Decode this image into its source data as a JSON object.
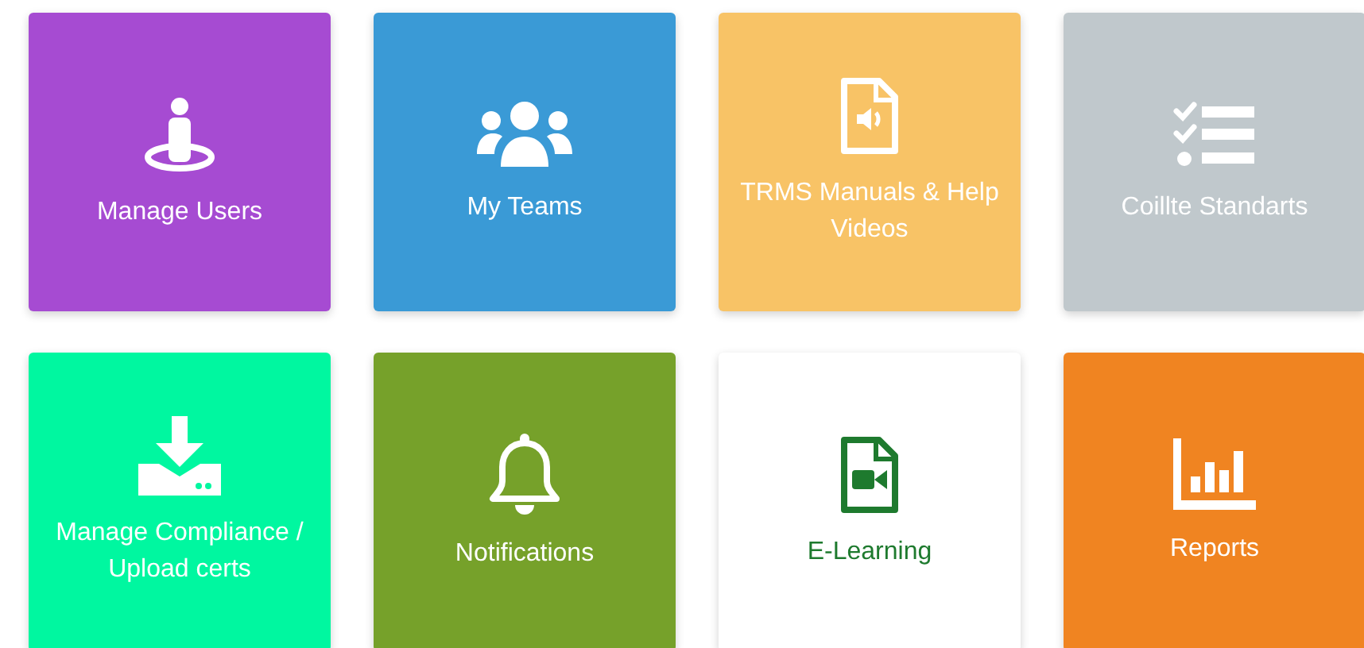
{
  "tiles": [
    {
      "label": "Manage Users",
      "color": "#a64bd2",
      "kind": "solid"
    },
    {
      "label": "My Teams",
      "color": "#3a9ad6",
      "kind": "solid"
    },
    {
      "label": "TRMS Manuals & Help Videos",
      "color": "#f8c366",
      "kind": "solid"
    },
    {
      "label": "Coillte Standarts",
      "color": "#c0c8cc",
      "kind": "solid"
    },
    {
      "label": "Manage Compliance / Upload certs",
      "color": "#00f7a0",
      "kind": "solid"
    },
    {
      "label": "Notifications",
      "color": "#76a12a",
      "kind": "solid"
    },
    {
      "label": "E-Learning",
      "color": "#ffffff",
      "kind": "outline"
    },
    {
      "label": "Reports",
      "color": "#f08421",
      "kind": "solid"
    }
  ]
}
